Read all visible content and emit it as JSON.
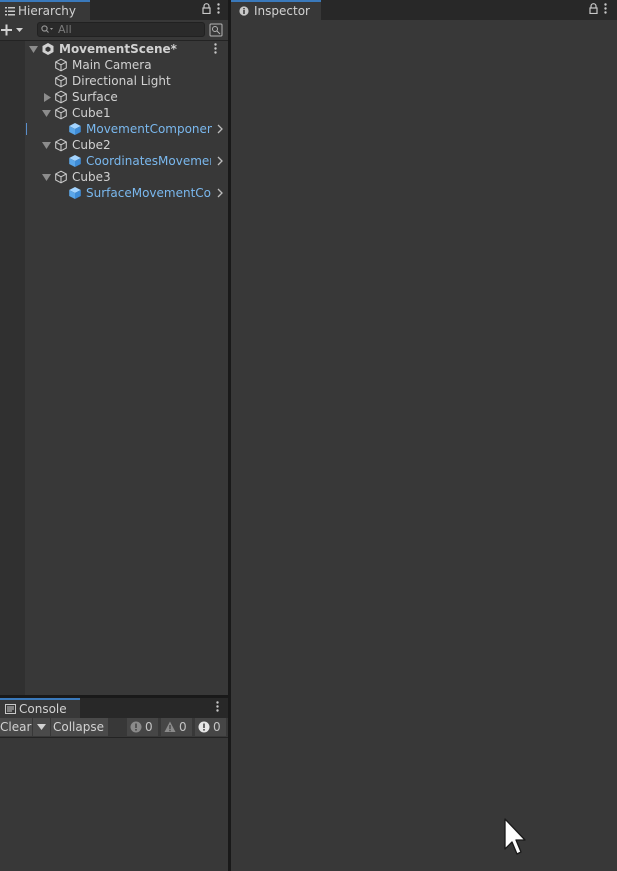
{
  "hierarchy": {
    "tab_title": "Hierarchy",
    "search_placeholder": "All",
    "items": [
      {
        "label": "MovementScene*"
      },
      {
        "label": "Main Camera"
      },
      {
        "label": "Directional Light"
      },
      {
        "label": "Surface"
      },
      {
        "label": "Cube1"
      },
      {
        "label": "MovementComponent"
      },
      {
        "label": "Cube2"
      },
      {
        "label": "CoordinatesMovement"
      },
      {
        "label": "Cube3"
      },
      {
        "label": "SurfaceMovementComponent"
      }
    ]
  },
  "inspector": {
    "tab_title": "Inspector"
  },
  "console": {
    "tab_title": "Console",
    "clear_label": "Clear",
    "collapse_label": "Collapse",
    "log_count": "0",
    "warning_count": "0",
    "error_count": "0"
  },
  "colors": {
    "panel_bg": "#383838",
    "tab_bg": "#282828",
    "prefab_text": "#7ab8ee",
    "accent": "#3a79bb"
  }
}
